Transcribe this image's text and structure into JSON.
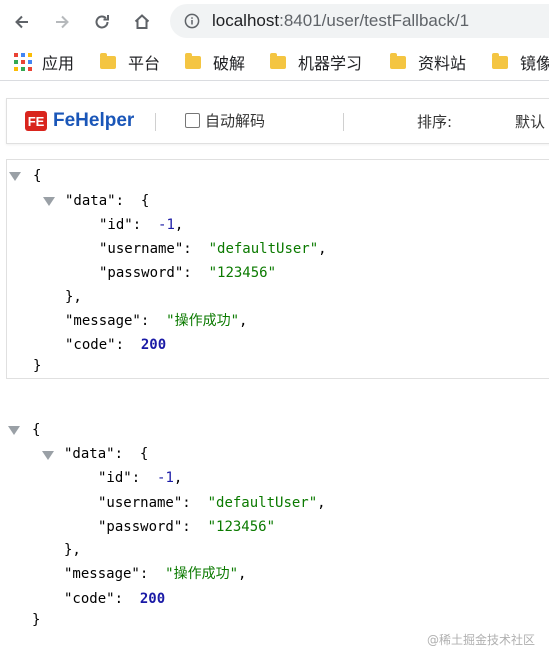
{
  "browser": {
    "url_host": "localhost",
    "url_rest": ":8401/user/testFallback/1",
    "bookmarks": [
      {
        "label": "应用",
        "icon": "apps-grid-icon"
      },
      {
        "label": "平台",
        "icon": "folder-icon"
      },
      {
        "label": "破解",
        "icon": "folder-icon"
      },
      {
        "label": "机器学习",
        "icon": "folder-icon"
      },
      {
        "label": "资料站",
        "icon": "folder-icon"
      },
      {
        "label": "镜像",
        "icon": "folder-icon"
      }
    ]
  },
  "fehelper": {
    "logo_mark": "FE",
    "name": "FeHelper",
    "auto_decode_label": "自动解码",
    "auto_decode_checked": false,
    "sort_label": "排序:",
    "sort_value": "默认"
  },
  "json_blocks": [
    {
      "data_key": "\"data\"",
      "id_key": "\"id\"",
      "id_value": "-1",
      "username_key": "\"username\"",
      "username_value": "\"defaultUser\"",
      "password_key": "\"password\"",
      "password_value": "\"123456\"",
      "message_key": "\"message\"",
      "message_value": "\"操作成功\"",
      "code_key": "\"code\"",
      "code_value": "200"
    },
    {
      "data_key": "\"data\"",
      "id_key": "\"id\"",
      "id_value": "-1",
      "username_key": "\"username\"",
      "username_value": "\"defaultUser\"",
      "password_key": "\"password\"",
      "password_value": "\"123456\"",
      "message_key": "\"message\"",
      "message_value": "\"操作成功\"",
      "code_key": "\"code\"",
      "code_value": "200"
    }
  ],
  "watermark": "@稀土掘金技术社区",
  "colors": {
    "string": "#0b7a00",
    "number": "#1a1aa6",
    "fehelper_blue": "#1a56b8",
    "fehelper_red": "#d9251d"
  }
}
